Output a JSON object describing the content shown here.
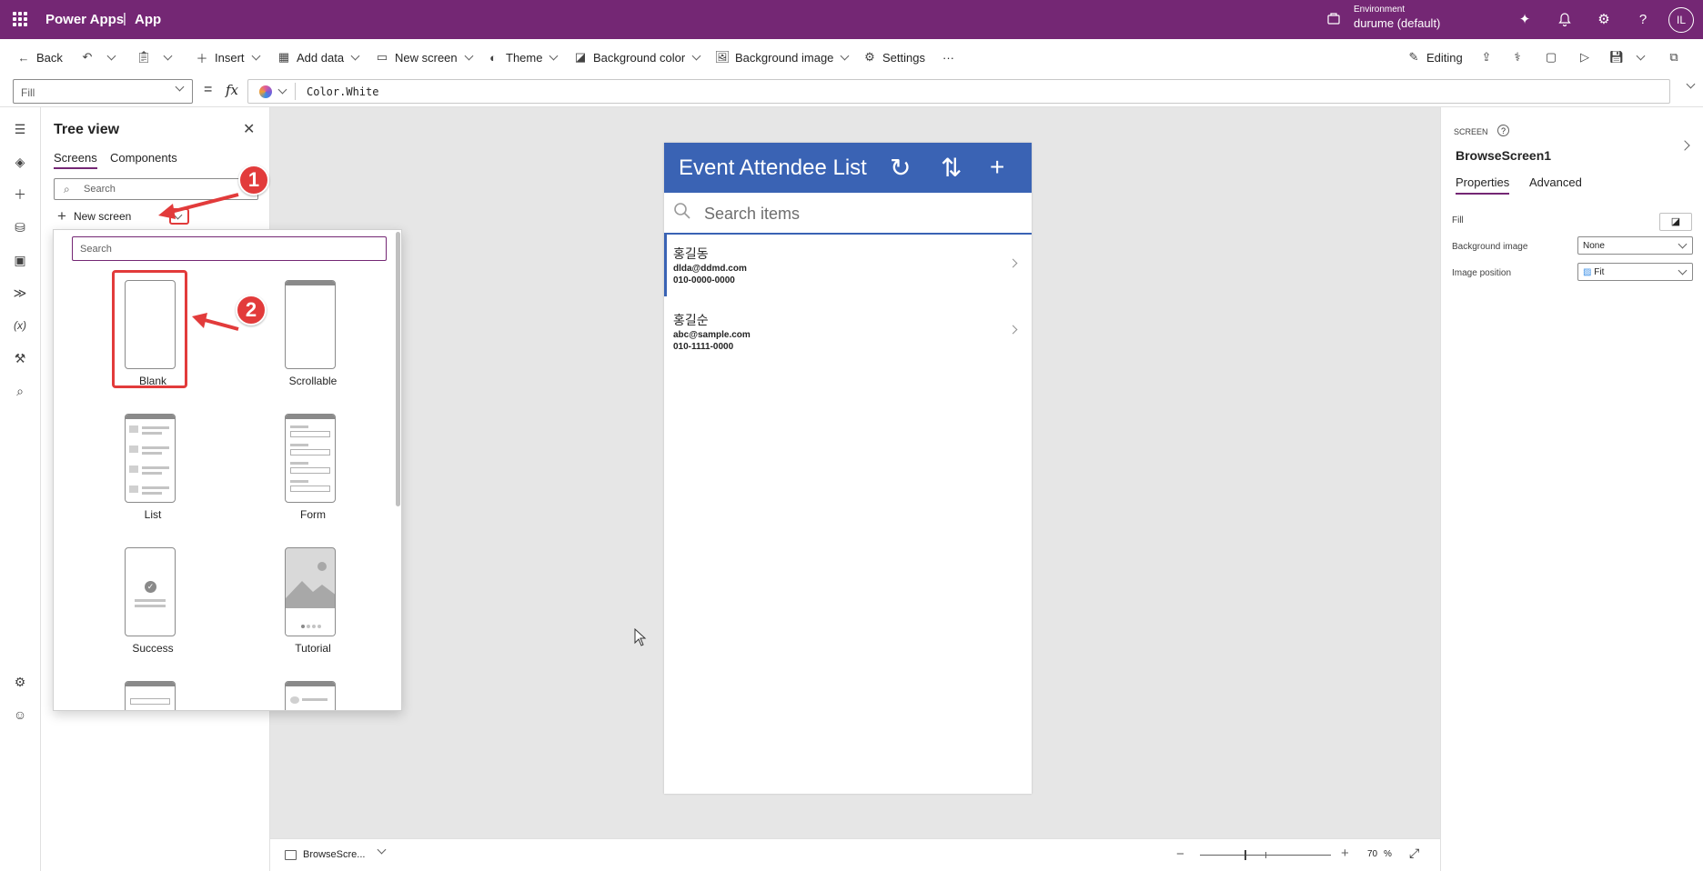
{
  "topbar": {
    "brand": "Power Apps",
    "separator": "|",
    "app": "App",
    "env_label": "Environment",
    "env_value": "durume (default)",
    "avatar_initials": "IL"
  },
  "commands": {
    "back": "Back",
    "insert": "Insert",
    "add_data": "Add data",
    "new_screen": "New screen",
    "theme": "Theme",
    "background_color": "Background color",
    "background_image": "Background image",
    "settings": "Settings",
    "more": "···",
    "editing": "Editing"
  },
  "formula_bar": {
    "property": "Fill",
    "equals": "=",
    "fx": "fx",
    "formula": "Color.White"
  },
  "tree_view": {
    "title": "Tree view",
    "tabs": [
      "Screens",
      "Components"
    ],
    "search_placeholder": "Search",
    "new_screen_label": "New screen"
  },
  "new_screen_popup": {
    "search_placeholder": "Search",
    "templates": [
      "Blank",
      "Scrollable",
      "List",
      "Form",
      "Success",
      "Tutorial"
    ]
  },
  "annotations": [
    "1",
    "2"
  ],
  "phone_app": {
    "title": "Event Attendee List",
    "search_placeholder": "Search items",
    "items": [
      {
        "name": "홍길동",
        "email": "dlda@ddmd.com",
        "phone": "010-0000-0000"
      },
      {
        "name": "홍길순",
        "email": "abc@sample.com",
        "phone": "010-1111-0000"
      }
    ]
  },
  "bottom_bar": {
    "screen_selector": "BrowseScre...",
    "zoom_value": "70",
    "zoom_unit": "%"
  },
  "right_pane": {
    "kind": "SCREEN",
    "help": "?",
    "screen_name": "BrowseScreen1",
    "tabs": [
      "Properties",
      "Advanced"
    ],
    "fill_label": "Fill",
    "background_image_label": "Background image",
    "background_image_value": "None",
    "image_position_label": "Image position",
    "image_position_value": "Fit"
  },
  "colors": {
    "brand": "#742774",
    "app_header": "#3a63b4",
    "annotation": "#e23b3b"
  }
}
